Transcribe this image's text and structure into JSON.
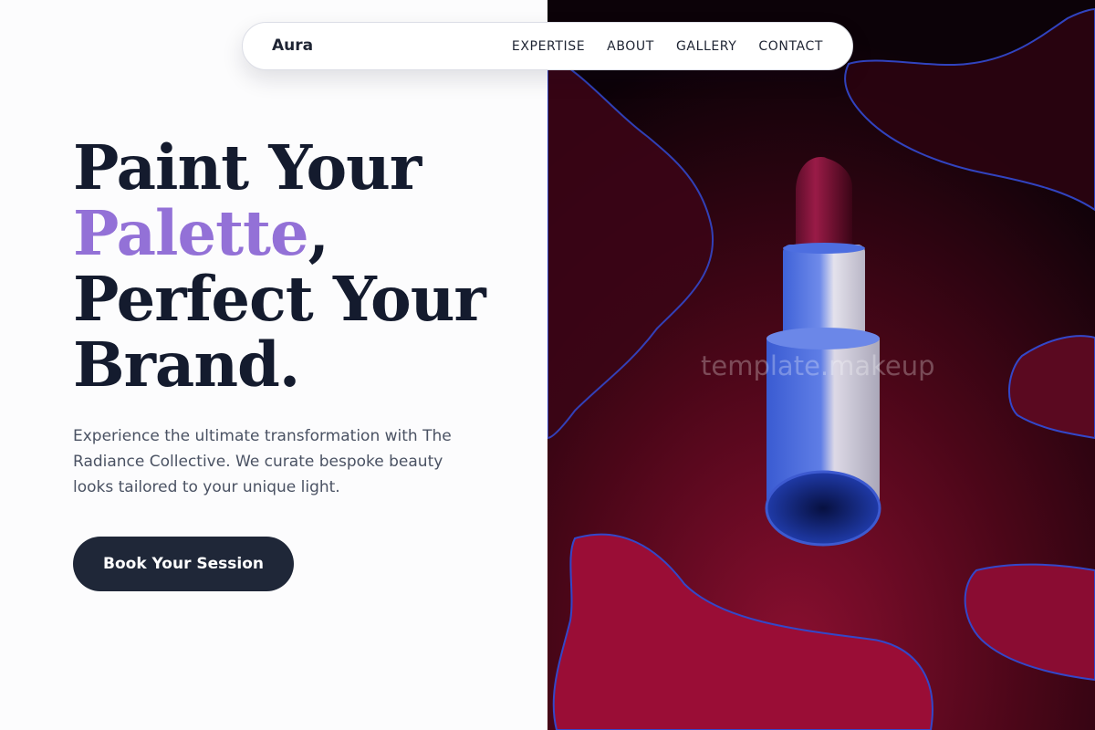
{
  "nav": {
    "brand": "Aura",
    "links": [
      "EXPERTISE",
      "ABOUT",
      "GALLERY",
      "CONTACT"
    ]
  },
  "hero": {
    "headline_line1": "Paint Your",
    "headline_accent": "Palette",
    "headline_comma": ",",
    "headline_line3": "Perfect Your",
    "headline_line4": "Brand.",
    "description": "Experience the ultimate transformation with The Radiance Collective. We curate bespoke beauty looks tailored to your unique light.",
    "cta_label": "Book Your Session",
    "image_subject": "lipstick"
  },
  "watermark": "template.makeup",
  "colors": {
    "accent_purple": "#9371d7",
    "headline_dark": "#141b2e",
    "button_dark": "#1f2738",
    "lipstick_red": "#b0103f"
  }
}
